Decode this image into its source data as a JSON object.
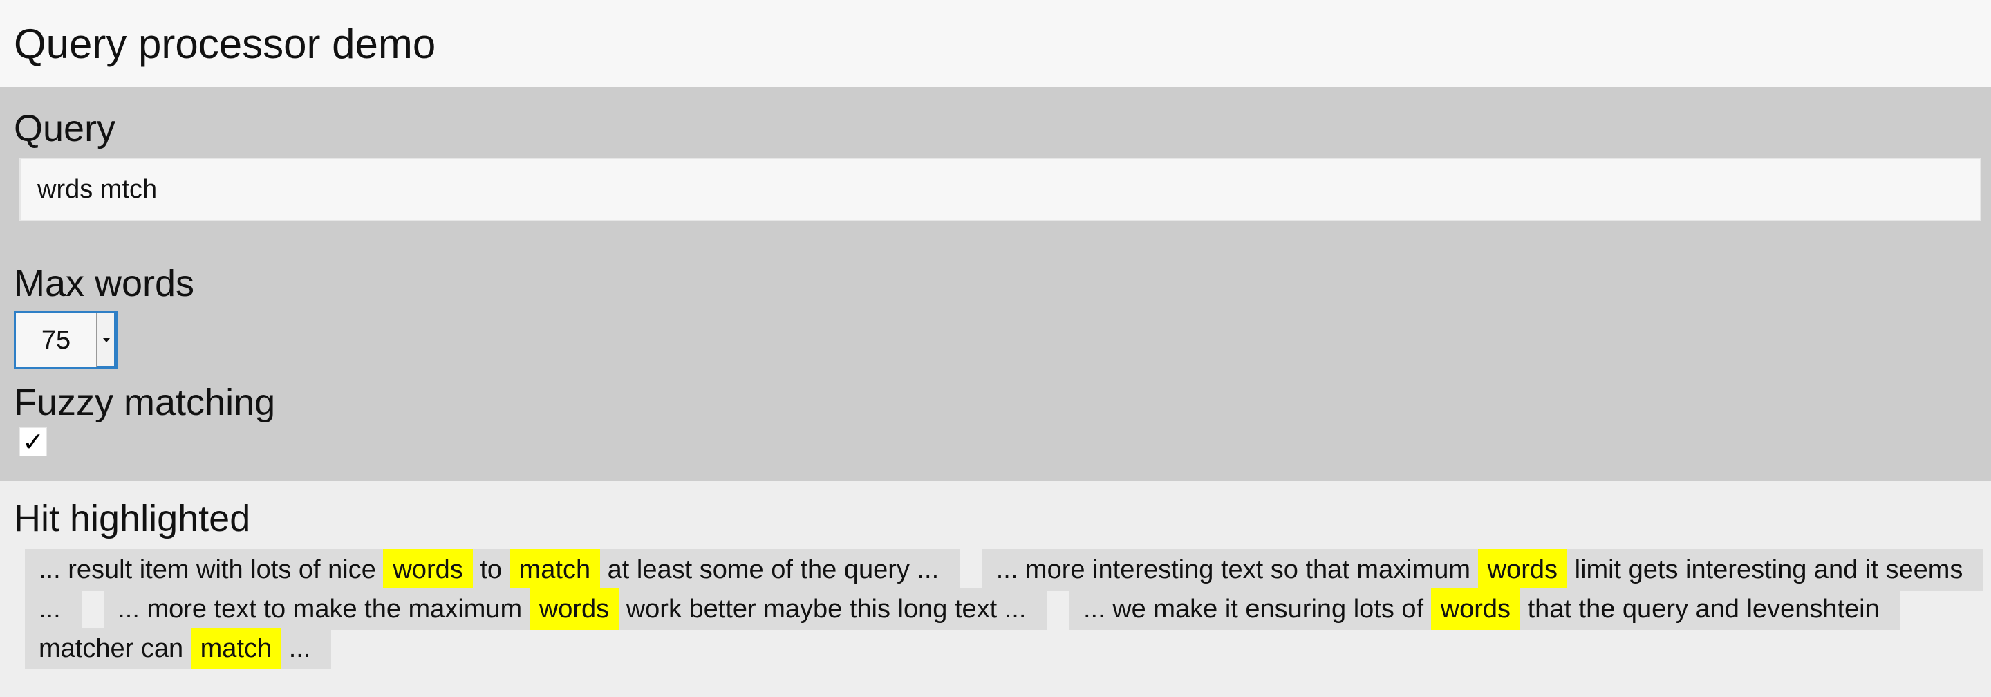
{
  "page": {
    "title": "Query processor demo"
  },
  "query": {
    "label": "Query",
    "value": "wrds mtch"
  },
  "max_words": {
    "label": "Max words",
    "value": "75"
  },
  "fuzzy": {
    "label": "Fuzzy matching",
    "checked": true,
    "checkmark": "✓"
  },
  "hits": {
    "label": "Hit highlighted",
    "snippets": [
      [
        {
          "text": "... result item with lots of nice",
          "hit": false
        },
        {
          "text": "words",
          "hit": true
        },
        {
          "text": "to",
          "hit": false
        },
        {
          "text": "match",
          "hit": true
        },
        {
          "text": "at least some of the query ...",
          "hit": false
        }
      ],
      [
        {
          "text": "... more interesting text so that maximum",
          "hit": false
        },
        {
          "text": "words",
          "hit": true
        },
        {
          "text": "limit gets interesting and it seems ...",
          "hit": false
        }
      ],
      [
        {
          "text": "... more text to make the maximum",
          "hit": false
        },
        {
          "text": "words",
          "hit": true
        },
        {
          "text": "work better maybe this long text ...",
          "hit": false
        }
      ],
      [
        {
          "text": "... we make it ensuring lots of",
          "hit": false
        },
        {
          "text": "words",
          "hit": true
        },
        {
          "text": "that the query and levenshtein matcher can",
          "hit": false
        },
        {
          "text": "match",
          "hit": true
        },
        {
          "text": "...",
          "hit": false
        }
      ]
    ]
  },
  "colors": {
    "controls_background": "#cccccc",
    "results_background": "#eeeeee",
    "highlight": "#ffff00",
    "snippet_background": "#dcdcdc",
    "focus_border": "#2e7fc6"
  }
}
